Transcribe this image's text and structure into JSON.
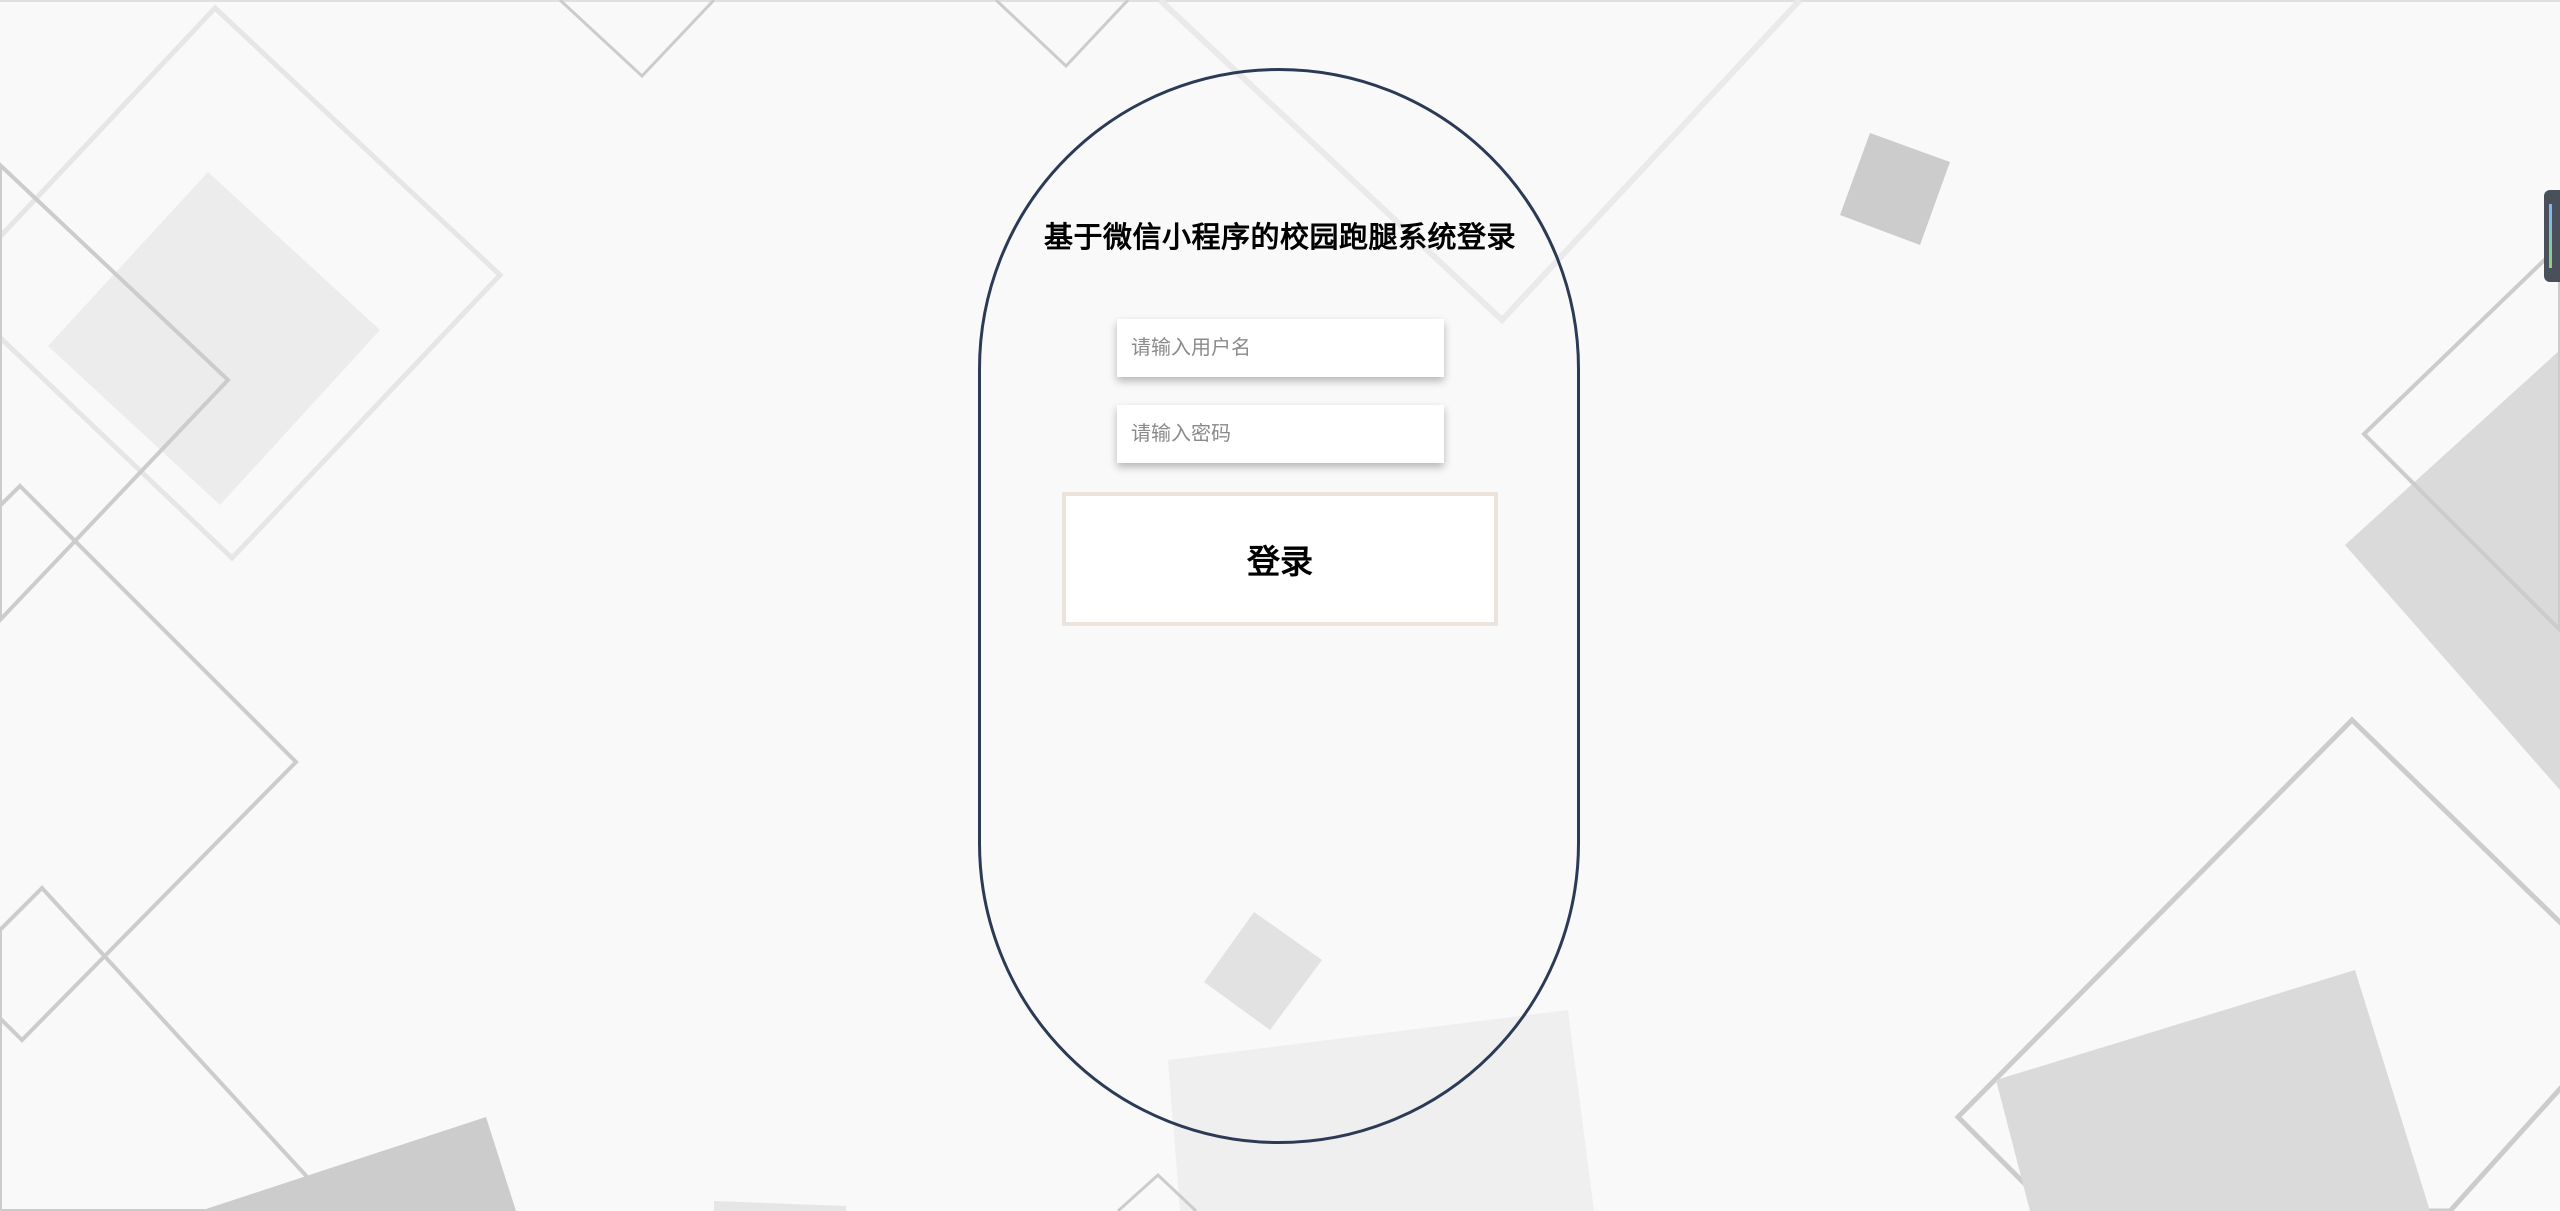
{
  "login": {
    "title": "基于微信小程序的校园跑腿系统登录",
    "username_placeholder": "请输入用户名",
    "password_placeholder": "请输入密码",
    "button_label": "登录"
  },
  "colors": {
    "background": "#f9f9f9",
    "card_border": "#2b3a55",
    "button_border": "#ece4db"
  }
}
